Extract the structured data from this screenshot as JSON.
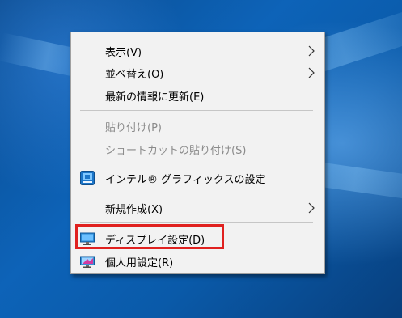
{
  "context_menu": {
    "items": [
      {
        "label": "表示(V)",
        "submenu": true,
        "disabled": false
      },
      {
        "label": "並べ替え(O)",
        "submenu": true,
        "disabled": false
      },
      {
        "label": "最新の情報に更新(E)",
        "submenu": false,
        "disabled": false
      },
      {
        "label": "貼り付け(P)",
        "submenu": false,
        "disabled": true
      },
      {
        "label": "ショートカットの貼り付け(S)",
        "submenu": false,
        "disabled": true
      },
      {
        "label": "インテル® グラフィックスの設定",
        "submenu": false,
        "disabled": false,
        "icon": "intel-graphics-icon"
      },
      {
        "label": "新規作成(X)",
        "submenu": true,
        "disabled": false
      },
      {
        "label": "ディスプレイ設定(D)",
        "submenu": false,
        "disabled": false,
        "icon": "display-settings-icon",
        "highlighted": true
      },
      {
        "label": "個人用設定(R)",
        "submenu": false,
        "disabled": false,
        "icon": "personalize-icon"
      }
    ]
  },
  "colors": {
    "highlight_border": "#e0211f",
    "menu_background": "#f2f2f2",
    "disabled_text": "#8a8a8a",
    "desktop_background": "#0d63b8"
  }
}
